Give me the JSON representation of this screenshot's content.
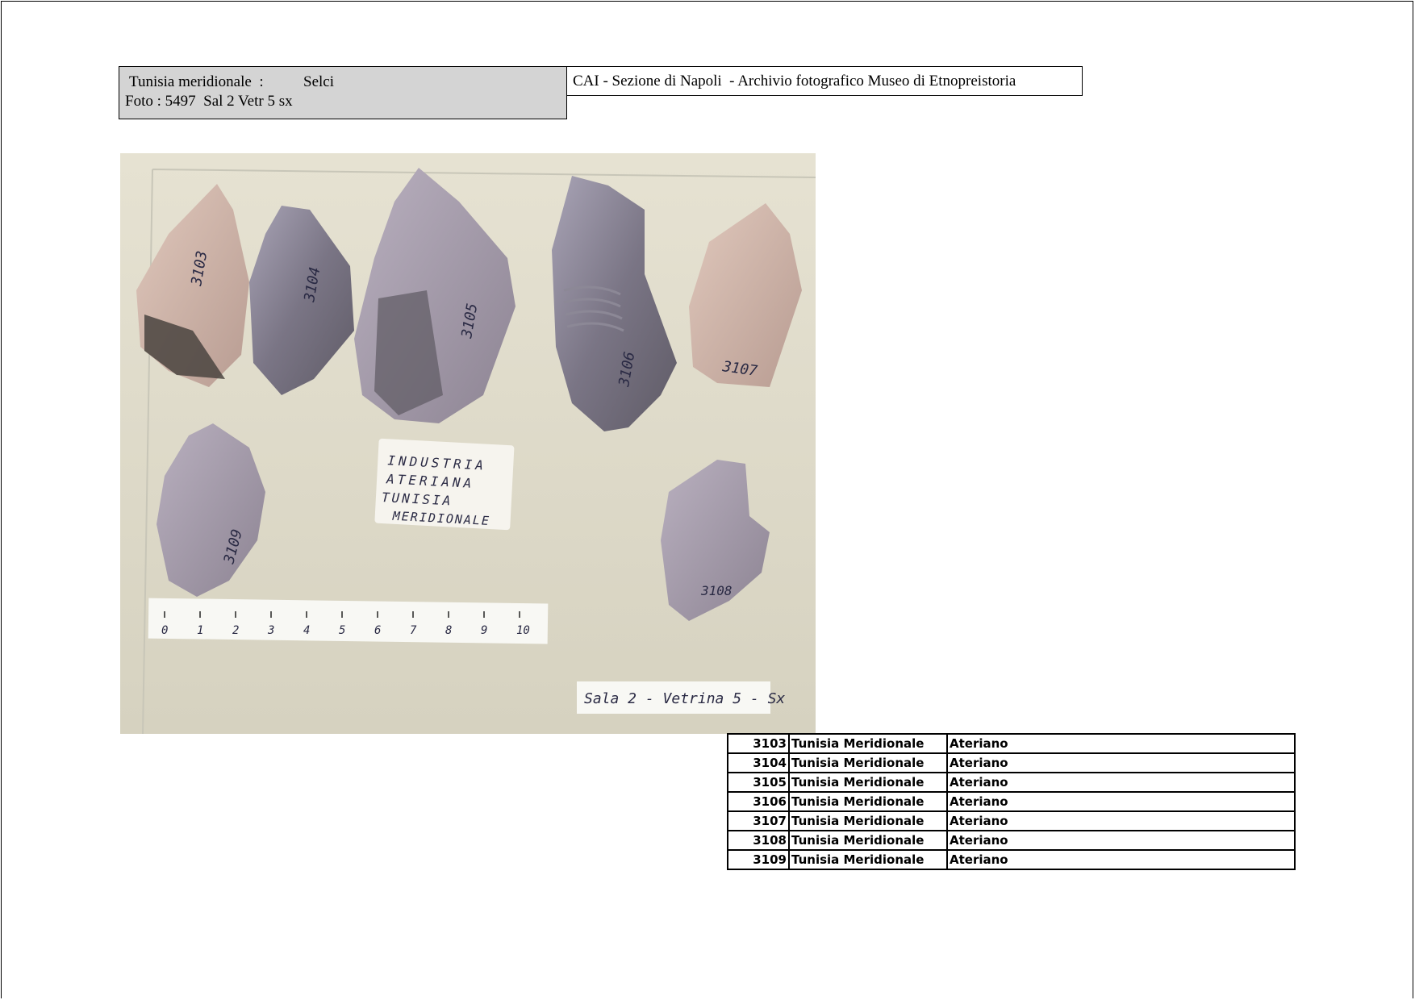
{
  "header": {
    "site": "Tunisia meridionale  :",
    "category": "Selci",
    "photo_ref": "Foto : 5497  Sal 2 Vetr 5 sx",
    "archive": "CAI - Sezione di Napoli  - Archivio fotografico Museo di Etnopreistoria"
  },
  "photo": {
    "artifact_numbers": [
      "3103",
      "3104",
      "3105",
      "3106",
      "3107",
      "3108",
      "3109"
    ],
    "label_card": [
      "INDUSTRIA",
      "ATERIANA",
      "TUNISIA",
      "MERIDIONALE"
    ],
    "ruler_ticks": [
      "0",
      "1",
      "2",
      "3",
      "4",
      "5",
      "6",
      "7",
      "8",
      "9",
      "10"
    ],
    "location_card": "Sala 2 - Vetrina 5 - Sx"
  },
  "catalog": [
    {
      "number": "3103",
      "locality": "Tunisia Meridionale",
      "culture": "Ateriano"
    },
    {
      "number": "3104",
      "locality": "Tunisia Meridionale",
      "culture": "Ateriano"
    },
    {
      "number": "3105",
      "locality": "Tunisia Meridionale",
      "culture": "Ateriano"
    },
    {
      "number": "3106",
      "locality": "Tunisia Meridionale",
      "culture": "Ateriano"
    },
    {
      "number": "3107",
      "locality": "Tunisia Meridionale",
      "culture": "Ateriano"
    },
    {
      "number": "3108",
      "locality": "Tunisia Meridionale",
      "culture": "Ateriano"
    },
    {
      "number": "3109",
      "locality": "Tunisia Meridionale",
      "culture": "Ateriano"
    }
  ]
}
